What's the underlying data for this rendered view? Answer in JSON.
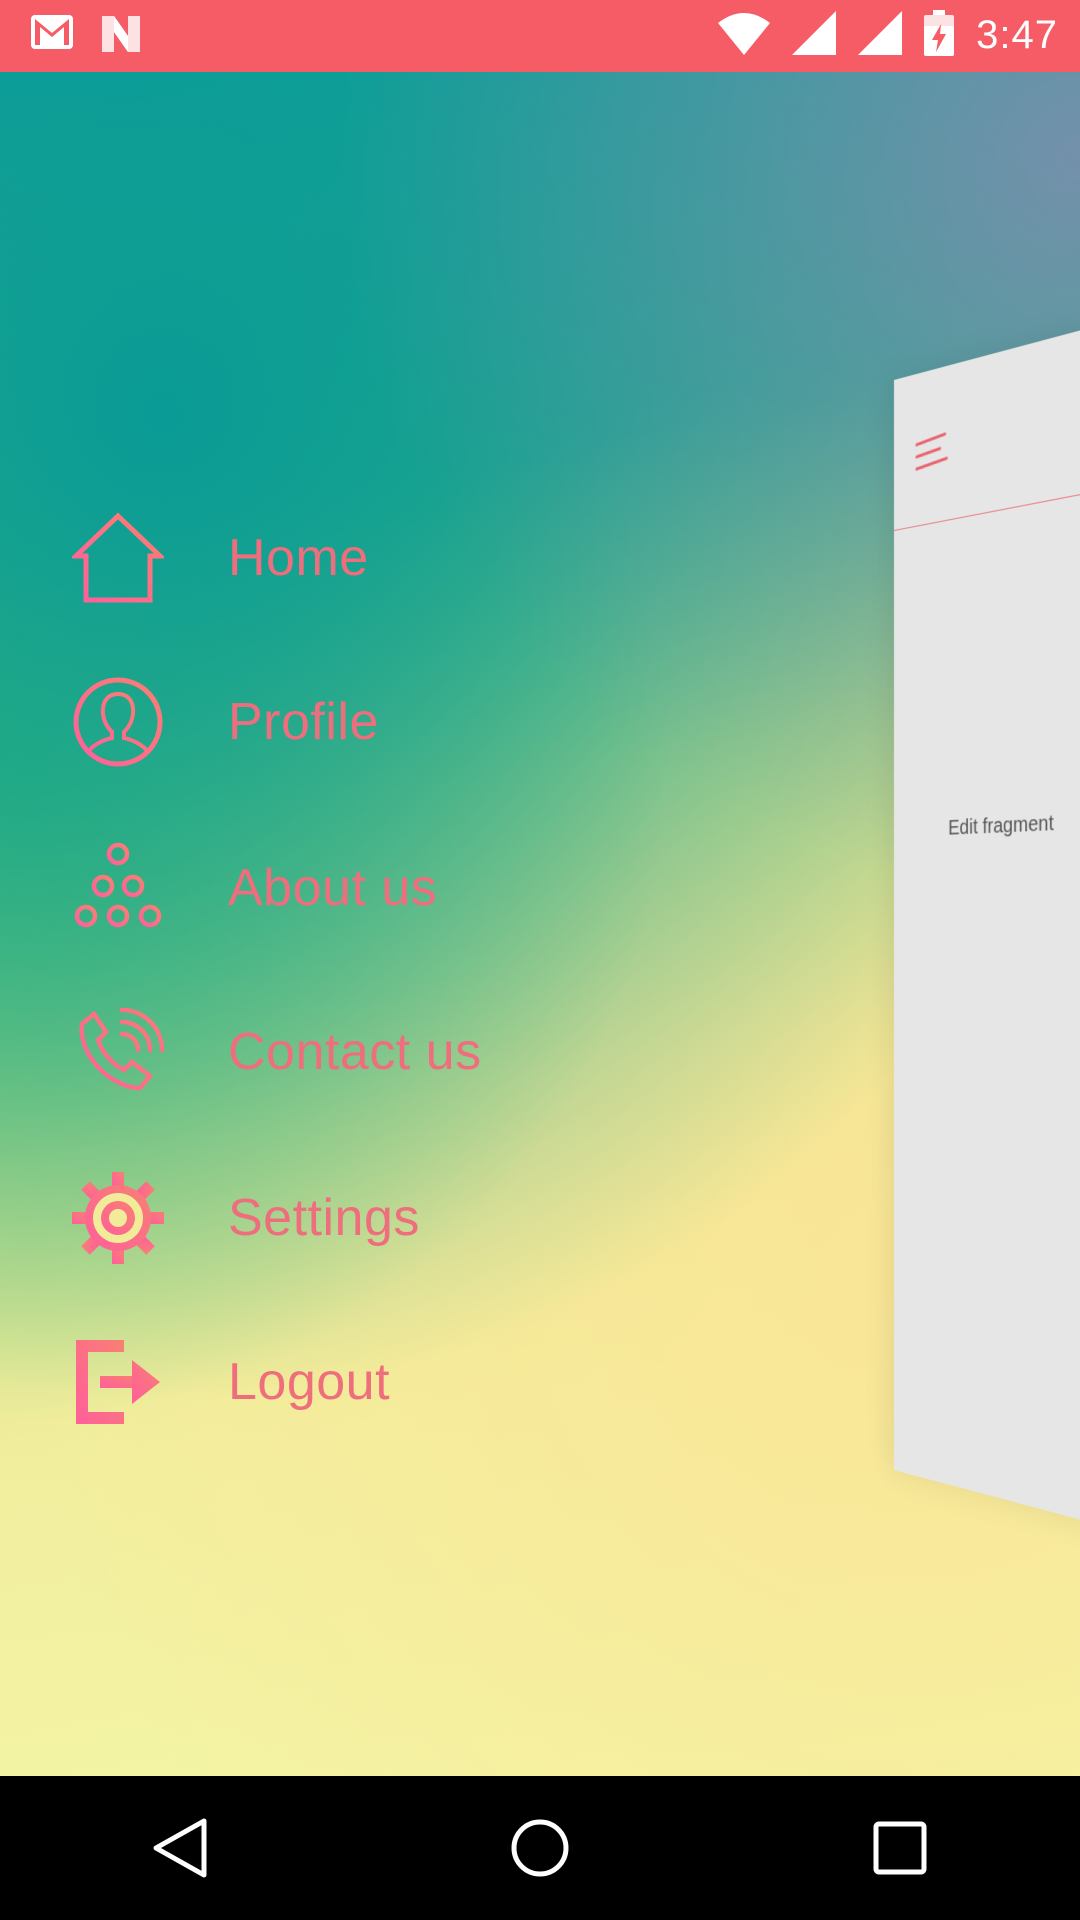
{
  "status_bar": {
    "time": "3:47",
    "icons": [
      "gmail-icon",
      "notification-n-icon",
      "wifi-icon",
      "signal-icon",
      "signal-icon",
      "battery-charging-icon"
    ]
  },
  "menu": {
    "items": [
      {
        "label": "Home",
        "icon": "home-icon"
      },
      {
        "label": "Profile",
        "icon": "profile-icon"
      },
      {
        "label": "About us",
        "icon": "about-icon"
      },
      {
        "label": "Contact us",
        "icon": "phone-icon"
      },
      {
        "label": "Settings",
        "icon": "gear-icon"
      },
      {
        "label": "Logout",
        "icon": "logout-icon"
      }
    ]
  },
  "content": {
    "fragment_text": "Edit fragment"
  },
  "nav_bar": {
    "buttons": [
      "back-icon",
      "home-circle-icon",
      "recents-icon"
    ]
  },
  "colors": {
    "status_bar": "#f65c66",
    "menu_text": "#ef6e7d",
    "icon_gradient_start": "#ff5f9b",
    "icon_gradient_end": "#f98072"
  }
}
